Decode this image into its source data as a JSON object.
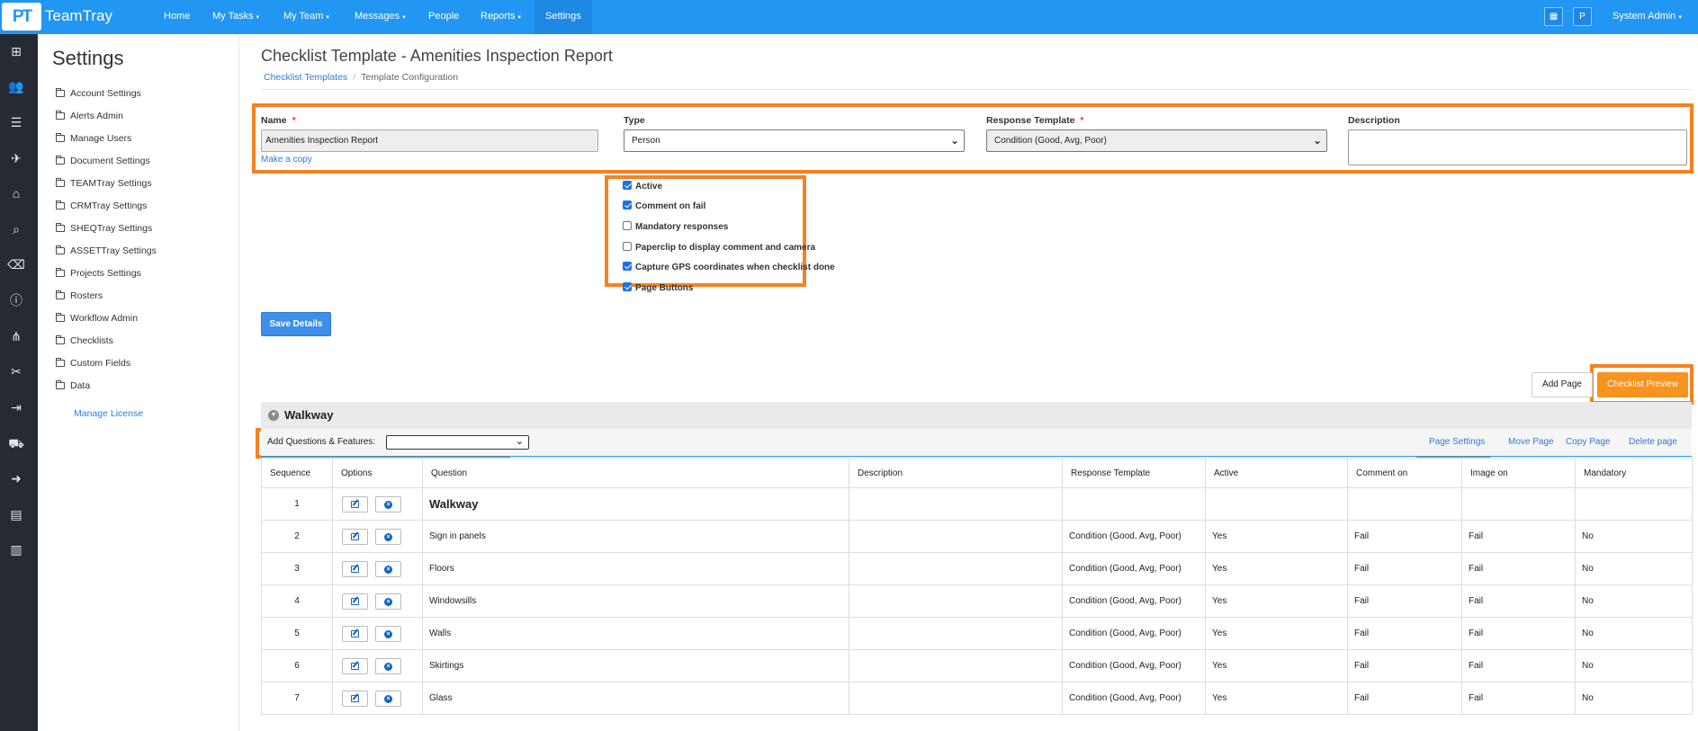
{
  "app": {
    "logo": "PT",
    "name": "TeamTray"
  },
  "topnav": [
    {
      "label": "Home",
      "caret": ""
    },
    {
      "label": "My Tasks",
      "caret": "▾"
    },
    {
      "label": "My Team",
      "caret": "▾"
    },
    {
      "label": "Messages",
      "caret": "▾"
    },
    {
      "label": "People",
      "caret": ""
    },
    {
      "label": "Reports",
      "caret": "▾"
    },
    {
      "label": "Settings",
      "caret": ""
    }
  ],
  "topbar_right": {
    "grid_icon": "grid-icon",
    "avatar_letter": "P",
    "user": "System Admin",
    "user_caret": "▾"
  },
  "rail_icons": [
    "dashboard-icon",
    "users-icon",
    "tray-icon",
    "plane-icon",
    "home-icon",
    "search-icon",
    "eraser-icon",
    "info-icon",
    "sitemap-icon",
    "tools-icon",
    "login-icon",
    "truck-icon",
    "arrow-right-icon",
    "calendar-icon",
    "book-icon"
  ],
  "sidebar": {
    "title": "Settings",
    "items": [
      "Account Settings",
      "Alerts Admin",
      "Manage Users",
      "Document Settings",
      "TEAMTray Settings",
      "CRMTray Settings",
      "SHEQTray Settings",
      "ASSETTray Settings",
      "Projects Settings",
      "Rosters",
      "Workflow Admin",
      "Checklists",
      "Custom Fields",
      "Data"
    ],
    "manage_license": "Manage License"
  },
  "page": {
    "title": "Checklist Template - Amenities Inspection Report",
    "breadcrumb": {
      "link": "Checklist Templates",
      "sep": "/",
      "current": "Template Configuration"
    }
  },
  "form": {
    "name_label": "Name",
    "required_mark": "*",
    "name_value": "Amenities Inspection Report",
    "make_copy": "Make a copy",
    "type_label": "Type",
    "type_value": "Person",
    "response_label": "Response Template",
    "response_value": "Condition (Good, Avg, Poor)",
    "description_label": "Description",
    "description_value": ""
  },
  "checkboxes": [
    {
      "label": "Active",
      "checked": true
    },
    {
      "label": "Comment on fail",
      "checked": true
    },
    {
      "label": "Mandatory responses",
      "checked": false
    },
    {
      "label": "Paperclip to display comment and camera",
      "checked": false
    },
    {
      "label": "Capture GPS coordinates when checklist done",
      "checked": true
    },
    {
      "label": "Page Buttons",
      "checked": true
    }
  ],
  "save_label": "Save Details",
  "add_page_label": "Add Page",
  "preview_label": "Checklist Preview",
  "page_section": {
    "name": "Walkway",
    "add_questions_label": "Add Questions & Features:",
    "add_questions_value": "",
    "links": [
      "Page Settings",
      "Move Page",
      "Copy Page",
      "Delete page"
    ]
  },
  "table": {
    "columns": [
      "Sequence",
      "Options",
      "Question",
      "Description",
      "Response Template",
      "Active",
      "Comment on",
      "Image on",
      "Mandatory"
    ],
    "rows": [
      {
        "seq": "1",
        "question": "Walkway",
        "description": "",
        "response": "",
        "active": "",
        "comment": "",
        "image": "",
        "mandatory": ""
      },
      {
        "seq": "2",
        "question": "Sign in panels",
        "description": "",
        "response": "Condition (Good, Avg, Poor)",
        "active": "Yes",
        "comment": "Fail",
        "image": "Fail",
        "mandatory": "No"
      },
      {
        "seq": "3",
        "question": "Floors",
        "description": "",
        "response": "Condition (Good, Avg, Poor)",
        "active": "Yes",
        "comment": "Fail",
        "image": "Fail",
        "mandatory": "No"
      },
      {
        "seq": "4",
        "question": "Windowsills",
        "description": "",
        "response": "Condition (Good, Avg, Poor)",
        "active": "Yes",
        "comment": "Fail",
        "image": "Fail",
        "mandatory": "No"
      },
      {
        "seq": "5",
        "question": "Walls",
        "description": "",
        "response": "Condition (Good, Avg, Poor)",
        "active": "Yes",
        "comment": "Fail",
        "image": "Fail",
        "mandatory": "No"
      },
      {
        "seq": "6",
        "question": "Skirtings",
        "description": "",
        "response": "Condition (Good, Avg, Poor)",
        "active": "Yes",
        "comment": "Fail",
        "image": "Fail",
        "mandatory": "No"
      },
      {
        "seq": "7",
        "question": "Glass",
        "description": "",
        "response": "Condition (Good, Avg, Poor)",
        "active": "Yes",
        "comment": "Fail",
        "image": "Fail",
        "mandatory": "No"
      }
    ]
  },
  "colors": {
    "topbar": "#2196f3",
    "rail": "#262b33",
    "highlight": "#f58220",
    "preview": "#f7931e",
    "link": "#2d7bd8"
  }
}
